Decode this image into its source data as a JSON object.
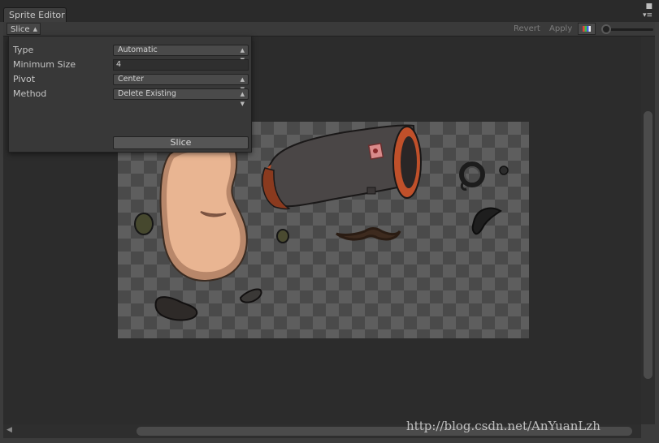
{
  "window": {
    "tab_title": "Sprite Editor"
  },
  "toolbar": {
    "mode_label": "Slice",
    "mode_arrow": "⬍",
    "revert_label": "Revert",
    "apply_label": "Apply"
  },
  "slice_panel": {
    "fields": [
      {
        "label": "Type",
        "value": "Automatic"
      },
      {
        "label": "Minimum Size",
        "value": "4"
      },
      {
        "label": "Pivot",
        "value": "Center"
      },
      {
        "label": "Method",
        "value": "Delete Existing"
      }
    ],
    "slice_button": "Slice"
  },
  "icons": {
    "tab_menu": "tab-menu-icon",
    "maximize": "maximize-icon",
    "color_channel": "color-channel-icon",
    "dropdown": "chevron-updown-icon"
  },
  "colors": {
    "window_bg": "#3c3c3c",
    "canvas_bg": "#2c2c2c",
    "skin": "#e9b592",
    "cannon_body": "#4a4646",
    "cannon_rim": "#c0502a",
    "mustache": "#3d2a1e"
  },
  "watermark": "http://blog.csdn.net/AnYuanLzh"
}
